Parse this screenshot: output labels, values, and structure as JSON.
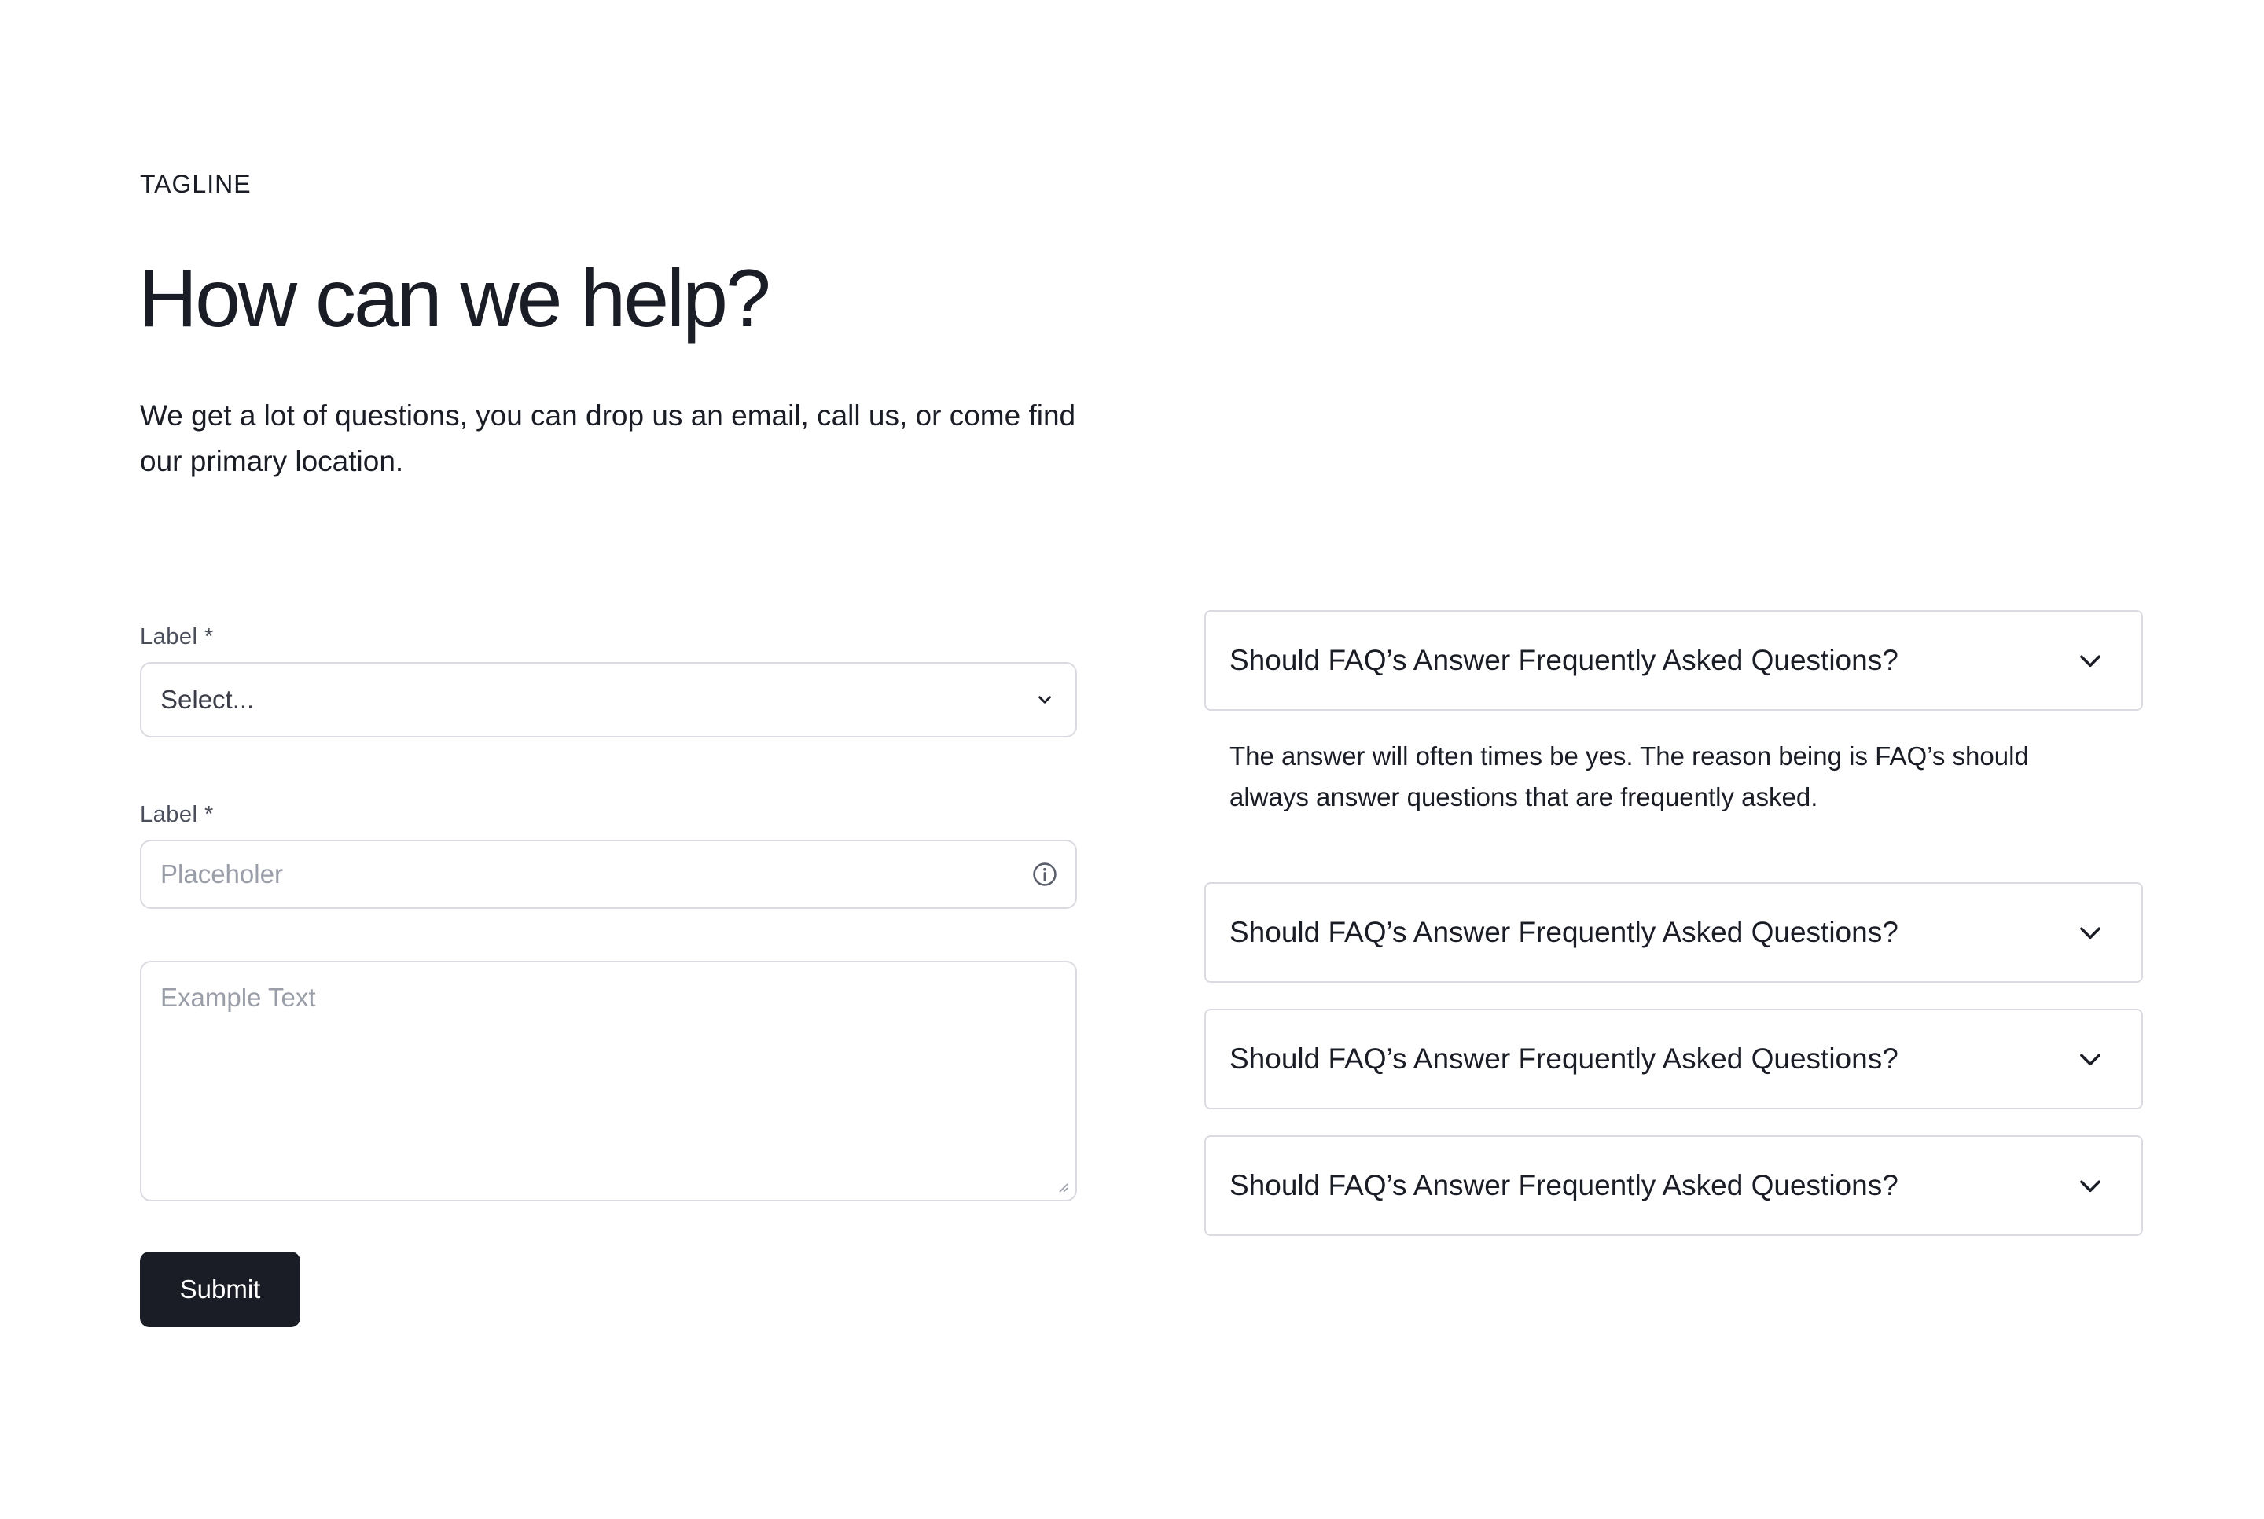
{
  "header": {
    "tagline": "TAGLINE",
    "title": "How can we help?",
    "intro": "We get a lot of questions, you can drop us an email, call us, or come find our primary location."
  },
  "form": {
    "select_label": "Label *",
    "select_value": "Select...",
    "input_label": "Label *",
    "input_placeholder": "Placeholer",
    "textarea_placeholder": "Example Text",
    "submit_label": "Submit"
  },
  "faq": {
    "items": [
      {
        "question": "Should FAQ’s Answer Frequently Asked Questions?",
        "expanded": true,
        "answer": "The answer will often times be yes. The reason being is FAQ’s should always answer questions that are frequently asked."
      },
      {
        "question": "Should FAQ’s Answer Frequently Asked Questions?",
        "expanded": false
      },
      {
        "question": "Should FAQ’s Answer Frequently Asked Questions?",
        "expanded": false
      },
      {
        "question": "Should FAQ’s Answer Frequently Asked Questions?",
        "expanded": false
      }
    ]
  },
  "icons": {
    "select_chevron": "chevron-down-icon",
    "input_info": "info-icon",
    "textarea_resize": "resize-handle-icon",
    "faq_chevron": "chevron-down-icon"
  },
  "colors": {
    "text": "#1b1d26",
    "border": "#d9dbe1",
    "placeholder": "#9a9ea8",
    "button_bg": "#1b1d26",
    "button_text": "#ffffff"
  }
}
